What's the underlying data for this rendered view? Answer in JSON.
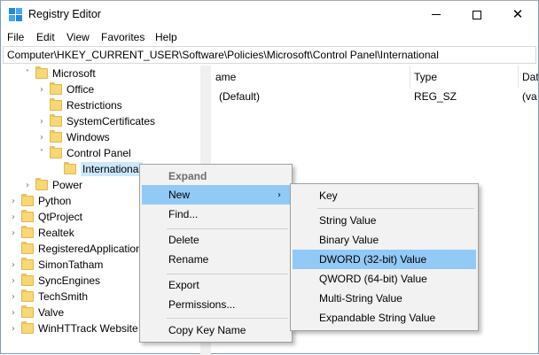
{
  "window": {
    "title": "Registry Editor",
    "minimize_glyph": "",
    "close_glyph": "✕"
  },
  "menubar": [
    "File",
    "Edit",
    "View",
    "Favorites",
    "Help"
  ],
  "address": "Computer\\HKEY_CURRENT_USER\\Software\\Policies\\Microsoft\\Control Panel\\International",
  "tree": [
    {
      "label": "Microsoft",
      "chev": "˅",
      "depth": 0
    },
    {
      "label": "Office",
      "chev": "›",
      "depth": 1
    },
    {
      "label": "Restrictions",
      "chev": "",
      "depth": 1
    },
    {
      "label": "SystemCertificates",
      "chev": "›",
      "depth": 1
    },
    {
      "label": "Windows",
      "chev": "›",
      "depth": 1
    },
    {
      "label": "Control Panel",
      "chev": "˅",
      "depth": 1
    },
    {
      "label": "International",
      "chev": "",
      "depth": 2,
      "selected": true
    },
    {
      "label": "Power",
      "chev": "›",
      "depth": 0
    },
    {
      "label": "Python",
      "chev": "›",
      "depth": -1
    },
    {
      "label": "QtProject",
      "chev": "›",
      "depth": -1
    },
    {
      "label": "Realtek",
      "chev": "›",
      "depth": -1
    },
    {
      "label": "RegisteredApplications",
      "chev": "",
      "depth": -1
    },
    {
      "label": "SimonTatham",
      "chev": "›",
      "depth": -1
    },
    {
      "label": "SyncEngines",
      "chev": "›",
      "depth": -1
    },
    {
      "label": "TechSmith",
      "chev": "›",
      "depth": -1
    },
    {
      "label": "Valve",
      "chev": "›",
      "depth": -1
    },
    {
      "label": "WinHTTrack Website",
      "chev": "›",
      "depth": -1
    }
  ],
  "list": {
    "columns": {
      "name": "ame",
      "type": "Type",
      "data": "Dat"
    },
    "rows": [
      {
        "name": "(Default)",
        "type": "REG_SZ",
        "data": "(va"
      }
    ]
  },
  "context_menu": {
    "items": [
      "Expand",
      "New",
      "Find...",
      "Delete",
      "Rename",
      "Export",
      "Permissions...",
      "Copy Key Name"
    ],
    "submenu_arrow": "›"
  },
  "new_submenu": {
    "items": [
      "Key",
      "String Value",
      "Binary Value",
      "DWORD (32-bit) Value",
      "QWORD (64-bit) Value",
      "Multi-String Value",
      "Expandable String Value"
    ]
  },
  "colors": {
    "highlight": "#91c9f7",
    "selection": "#cce8ff",
    "folder": "#f8d775"
  }
}
